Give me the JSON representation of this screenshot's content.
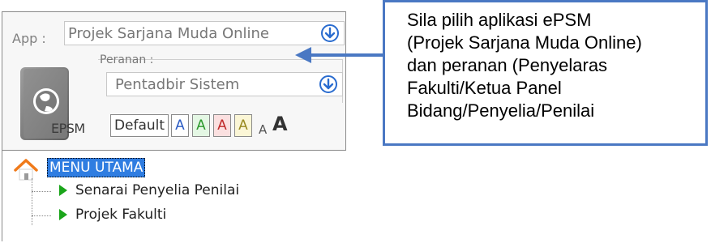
{
  "app_selector": {
    "label": "App :",
    "value": "Projek Sarjana Muda Online"
  },
  "logo": {
    "text": "EPSM"
  },
  "role_selector": {
    "label": "Peranan :",
    "value": "Pentadbir Sistem"
  },
  "font_controls": {
    "default_label": "Default",
    "theme_blue": "A",
    "theme_green": "A",
    "theme_red": "A",
    "theme_yellow": "A",
    "smaller": "A",
    "larger": "A"
  },
  "tree": {
    "root": "MENU UTAMA",
    "items": [
      {
        "label": "Senarai Penyelia Penilai"
      },
      {
        "label": "Projek Fakulti"
      }
    ]
  },
  "callout": {
    "text": "Sila pilih aplikasi ePSM\n(Projek Sarjana Muda Online)\ndan peranan (Penyelaras\nFakulti/Ketua Panel\nBidang/Penyelia/Penilai"
  },
  "colors": {
    "accent_blue": "#2a6ccf",
    "callout_border": "#4a78c3",
    "tree_selection": "#2f7de1",
    "tree_arrow": "#1aa51a"
  }
}
